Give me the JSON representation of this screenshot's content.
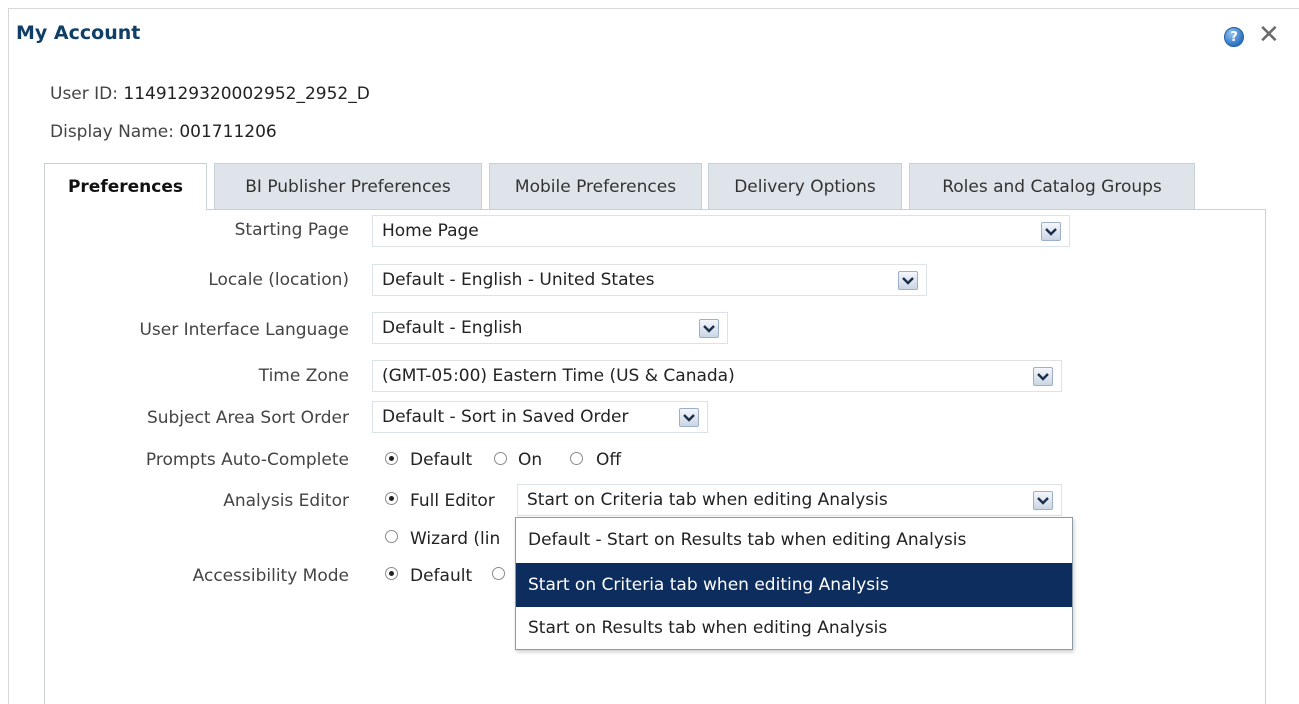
{
  "dialog": {
    "title": "My Account",
    "help_glyph": "?",
    "close_glyph": "✕"
  },
  "user": {
    "id_label": "User ID:",
    "id_value": "1149129320002952_2952_D",
    "display_label": "Display Name:",
    "display_value": "001711206"
  },
  "tabs": [
    {
      "label": "Preferences",
      "active": true
    },
    {
      "label": "BI Publisher Preferences",
      "active": false
    },
    {
      "label": "Mobile Preferences",
      "active": false
    },
    {
      "label": "Delivery Options",
      "active": false
    },
    {
      "label": "Roles and Catalog Groups",
      "active": false
    }
  ],
  "prefs": {
    "starting_page": {
      "label": "Starting Page",
      "value": "Home Page"
    },
    "locale": {
      "label": "Locale (location)",
      "value": "Default - English - United States"
    },
    "ui_language": {
      "label": "User Interface Language",
      "value": "Default - English"
    },
    "time_zone": {
      "label": "Time Zone",
      "value": "(GMT-05:00) Eastern Time (US & Canada)"
    },
    "sort_order": {
      "label": "Subject Area Sort Order",
      "value": "Default - Sort in Saved Order"
    },
    "prompts": {
      "label": "Prompts Auto-Complete",
      "options": [
        "Default",
        "On",
        "Off"
      ],
      "selected": "Default"
    },
    "analysis_editor": {
      "label": "Analysis Editor",
      "full_editor": "Full Editor",
      "wizard": "Wizard (lin",
      "selected": "Full Editor",
      "select_value": "Start on Criteria tab when editing Analysis"
    },
    "accessibility": {
      "label": "Accessibility Mode",
      "default": "Default",
      "selected": "Default"
    }
  },
  "dropdown": {
    "options": [
      "Default - Start on Results tab when editing Analysis",
      "Start on Criteria tab when editing Analysis",
      "Start on Results tab when editing Analysis"
    ],
    "highlighted": "Start on Criteria tab when editing Analysis"
  },
  "colors": {
    "title": "#0f3f66",
    "highlight": "#0d2d5e",
    "tab_bg": "#dfe4ea"
  }
}
